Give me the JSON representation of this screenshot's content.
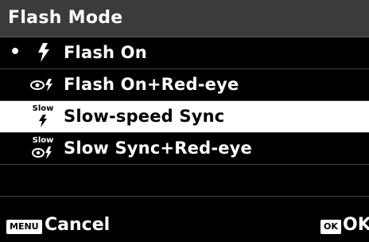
{
  "title": "Flash Mode",
  "items": [
    {
      "label": "Flash On",
      "icon": "flash-icon",
      "active": true
    },
    {
      "label": "Flash On+Red-eye",
      "icon": "red-eye-flash-icon"
    },
    {
      "label": "Slow-speed Sync",
      "icon": "slow-sync-icon",
      "selected": true,
      "icon_text": "Slow"
    },
    {
      "label": "Slow Sync+Red-eye",
      "icon": "slow-sync-red-eye-icon",
      "icon_text": "Slow"
    }
  ],
  "bullet": "•",
  "footer": {
    "menu_badge": "MENU",
    "cancel_label": "Cancel",
    "ok_badge": "OK",
    "ok_label": "OK"
  }
}
